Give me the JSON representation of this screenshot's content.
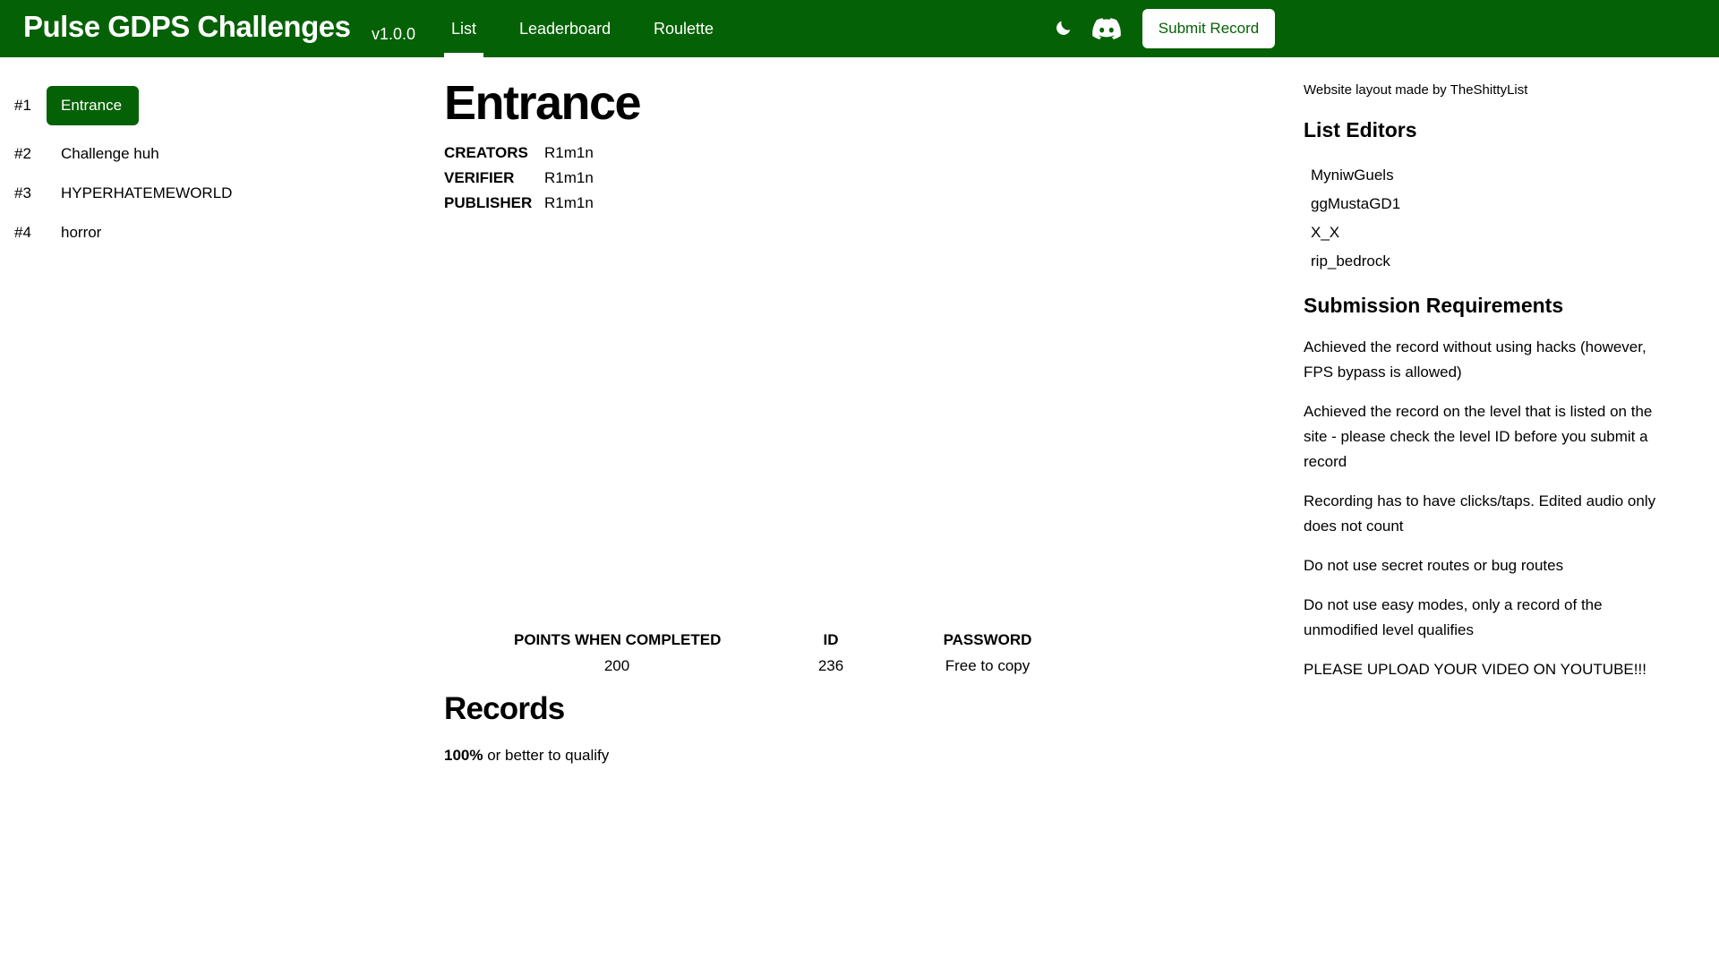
{
  "header": {
    "brand": "Pulse GDPS Challenges",
    "version": "v1.0.0",
    "nav": [
      "List",
      "Leaderboard",
      "Roulette"
    ],
    "active_nav": "List",
    "icons": [
      "moon-icon",
      "discord-icon"
    ],
    "submit_label": "Submit Record",
    "bg_color": "#056105"
  },
  "levels": [
    {
      "rank": "#1",
      "name": "Entrance",
      "active": true
    },
    {
      "rank": "#2",
      "name": "Challenge huh"
    },
    {
      "rank": "#3",
      "name": "HYPERHATEMEWORLD"
    },
    {
      "rank": "#4",
      "name": "horror"
    }
  ],
  "main": {
    "title": "Entrance",
    "meta": [
      {
        "key": "CREATORS",
        "value": "R1m1n"
      },
      {
        "key": "VERIFIER",
        "value": "R1m1n"
      },
      {
        "key": "PUBLISHER",
        "value": "R1m1n"
      }
    ],
    "stats": [
      {
        "label": "POINTS WHEN COMPLETED",
        "value": "200"
      },
      {
        "label": "ID",
        "value": "236"
      },
      {
        "label": "PASSWORD",
        "value": "Free to copy"
      }
    ],
    "records_title": "Records",
    "qualify_percent": "100%",
    "qualify_text": " or better to qualify"
  },
  "sidebar": {
    "credit": "Website layout made by TheShittyList",
    "editors_title": "List Editors",
    "editors": [
      "MyniwGuels",
      "ggMustaGD1",
      "X_X",
      "rip_bedrock"
    ],
    "requirements_title": "Submission Requirements",
    "requirements": [
      "Achieved the record without using hacks (however, FPS bypass is allowed)",
      "Achieved the record on the level that is listed on the site - please check the level ID before you submit a record",
      "Recording has to have clicks/taps. Edited audio only does not count",
      "Do not use secret routes or bug routes",
      "Do not use easy modes, only a record of the unmodified level qualifies",
      "PLEASE UPLOAD YOUR VIDEO ON YOUTUBE!!!"
    ]
  }
}
